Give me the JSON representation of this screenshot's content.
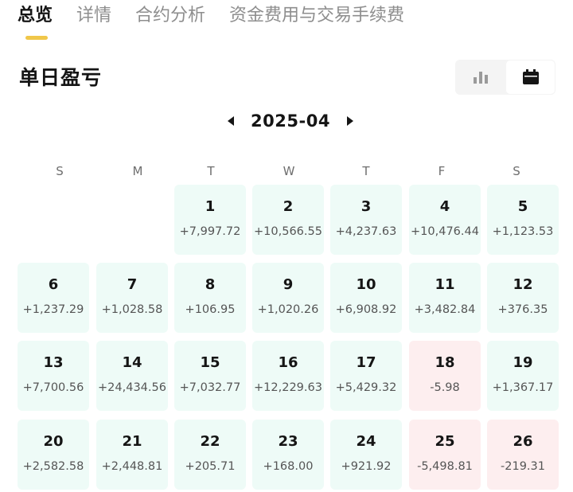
{
  "tabs": [
    {
      "label": "总览",
      "active": true
    },
    {
      "label": "详情",
      "active": false
    },
    {
      "label": "合约分析",
      "active": false
    },
    {
      "label": "资金费用与交易手续费",
      "active": false
    }
  ],
  "section_title": "单日盈亏",
  "view_toggle": {
    "options": [
      "bar-chart-icon",
      "calendar-icon"
    ],
    "selected": "calendar-icon"
  },
  "calendar": {
    "month": "2025-04",
    "weekdays": [
      "S",
      "M",
      "T",
      "W",
      "T",
      "F",
      "S"
    ],
    "first_weekday_index": 2,
    "days": [
      {
        "day": "1",
        "pnl": "+7,997.72"
      },
      {
        "day": "2",
        "pnl": "+10,566.55"
      },
      {
        "day": "3",
        "pnl": "+4,237.63"
      },
      {
        "day": "4",
        "pnl": "+10,476.44"
      },
      {
        "day": "5",
        "pnl": "+1,123.53"
      },
      {
        "day": "6",
        "pnl": "+1,237.29"
      },
      {
        "day": "7",
        "pnl": "+1,028.58"
      },
      {
        "day": "8",
        "pnl": "+106.95"
      },
      {
        "day": "9",
        "pnl": "+1,020.26"
      },
      {
        "day": "10",
        "pnl": "+6,908.92"
      },
      {
        "day": "11",
        "pnl": "+3,482.84"
      },
      {
        "day": "12",
        "pnl": "+376.35"
      },
      {
        "day": "13",
        "pnl": "+7,700.56"
      },
      {
        "day": "14",
        "pnl": "+24,434.56"
      },
      {
        "day": "15",
        "pnl": "+7,032.77"
      },
      {
        "day": "16",
        "pnl": "+12,229.63"
      },
      {
        "day": "17",
        "pnl": "+5,429.32"
      },
      {
        "day": "18",
        "pnl": "-5.98"
      },
      {
        "day": "19",
        "pnl": "+1,367.17"
      },
      {
        "day": "20",
        "pnl": "+2,582.58"
      },
      {
        "day": "21",
        "pnl": "+2,448.81"
      },
      {
        "day": "22",
        "pnl": "+205.71"
      },
      {
        "day": "23",
        "pnl": "+168.00"
      },
      {
        "day": "24",
        "pnl": "+921.92"
      },
      {
        "day": "25",
        "pnl": "-5,498.81"
      },
      {
        "day": "26",
        "pnl": "-219.31"
      }
    ]
  },
  "colors": {
    "profit_cell": "#eefbf7",
    "loss_cell": "#fdeeef",
    "tab_indicator": "#f0c74a"
  }
}
